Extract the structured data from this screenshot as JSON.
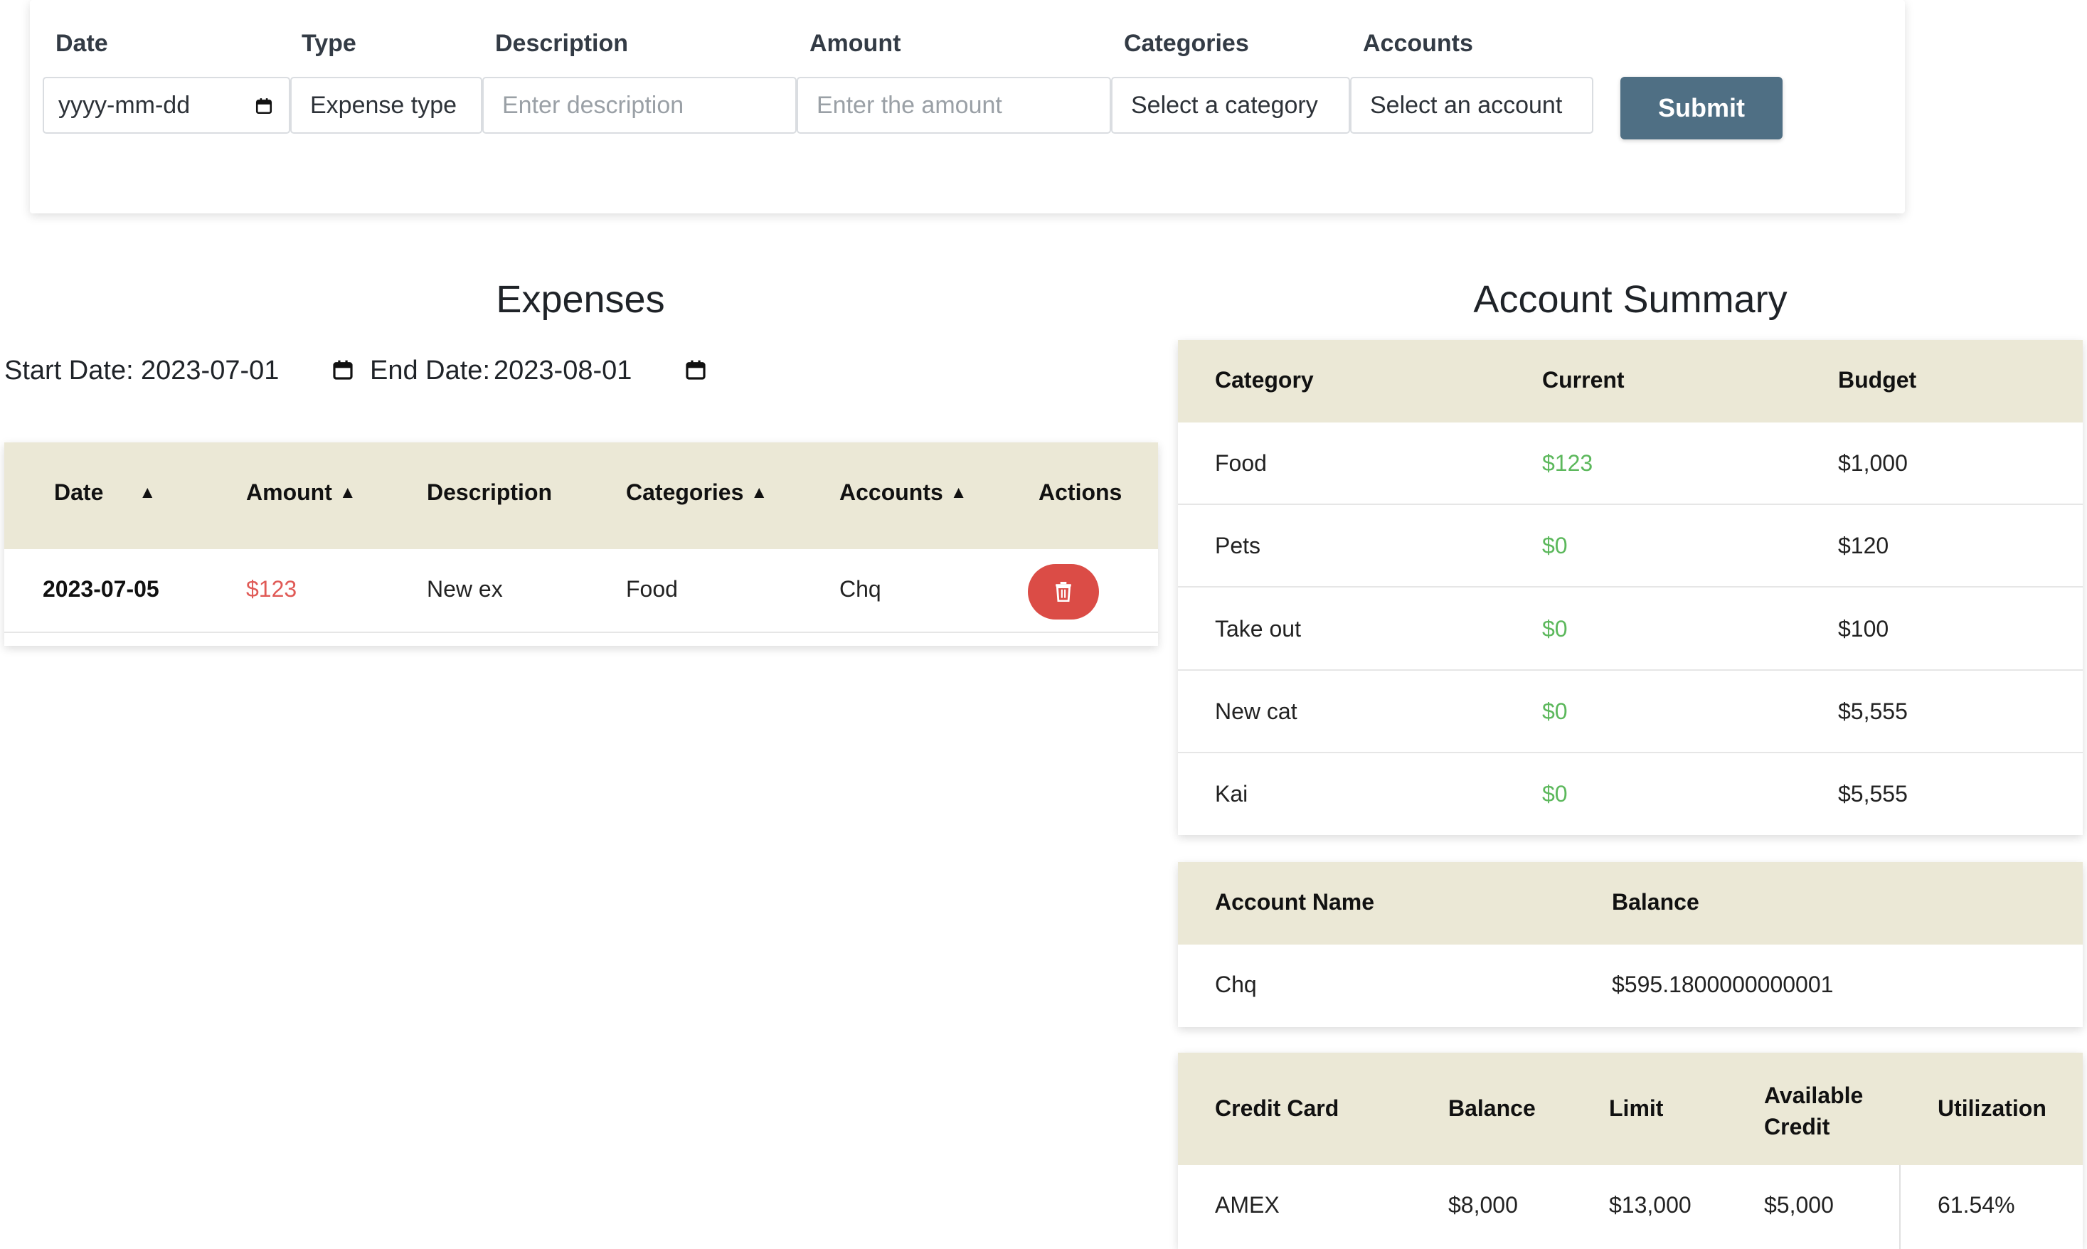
{
  "form": {
    "labels": {
      "date": "Date",
      "type": "Type",
      "description": "Description",
      "amount": "Amount",
      "categories": "Categories",
      "accounts": "Accounts"
    },
    "date_placeholder": "yyyy-mm-dd",
    "type_value": "Expense type",
    "description_placeholder": "Enter description",
    "amount_placeholder": "Enter the amount",
    "category_value": "Select a category",
    "account_value": "Select an account",
    "submit_label": "Submit"
  },
  "expenses": {
    "title": "Expenses",
    "start_label": "Start Date:",
    "start_value": "2023-07-01",
    "end_label": "End Date:",
    "end_value": "2023-08-01",
    "headers": [
      "Date",
      "Amount",
      "Description",
      "Categories",
      "Accounts",
      "Actions"
    ],
    "rows": [
      {
        "date": "2023-07-05",
        "amount": "$123",
        "description": "New ex",
        "category": "Food",
        "account": "Chq"
      }
    ]
  },
  "summary": {
    "title": "Account Summary",
    "category_table": {
      "headers": [
        "Category",
        "Current",
        "Budget"
      ],
      "rows": [
        {
          "category": "Food",
          "current": "$123",
          "budget": "$1,000"
        },
        {
          "category": "Pets",
          "current": "$0",
          "budget": "$120"
        },
        {
          "category": "Take out",
          "current": "$0",
          "budget": "$100"
        },
        {
          "category": "New cat",
          "current": "$0",
          "budget": "$5,555"
        },
        {
          "category": "Kai",
          "current": "$0",
          "budget": "$5,555"
        }
      ]
    },
    "account_table": {
      "headers": [
        "Account Name",
        "Balance"
      ],
      "rows": [
        {
          "name": "Chq",
          "balance": "$595.1800000000001"
        }
      ]
    },
    "credit_table": {
      "headers": [
        "Credit Card",
        "Balance",
        "Limit",
        "Available Credit",
        "Utilization"
      ],
      "available_line1": "Available",
      "available_line2": "Credit",
      "rows": [
        {
          "card": "AMEX",
          "balance": "$8,000",
          "limit": "$13,000",
          "available": "$5,000",
          "utilization": "61.54%"
        }
      ]
    }
  },
  "colors": {
    "submit": "#4f6f84",
    "header_bg": "#ebe8d6",
    "positive": "#5cb85c",
    "negative": "#e05a56",
    "delete": "#db4c46"
  }
}
